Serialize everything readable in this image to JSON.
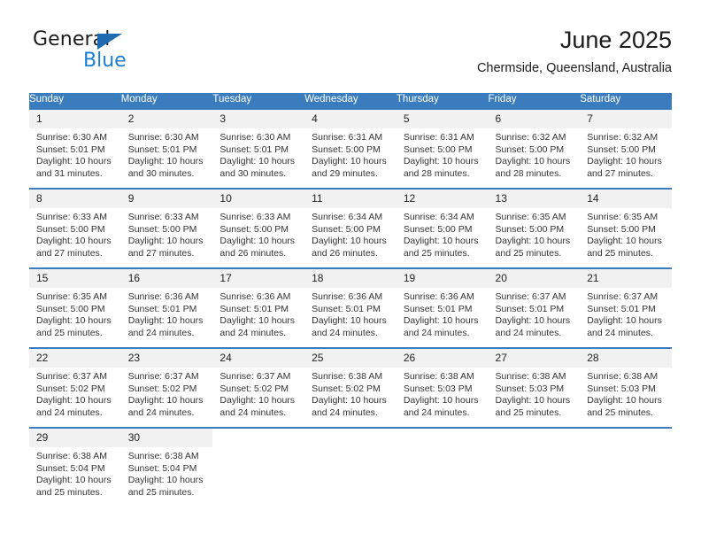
{
  "brand": {
    "word_one": "General",
    "word_two": "Blue",
    "triangle_icon": "triangle-icon",
    "accent_dark": "#1e69b0",
    "accent_light": "#1a7fd4"
  },
  "header": {
    "title": "June 2025",
    "location": "Chermside, Queensland, Australia"
  },
  "theme": {
    "header_blue": "#3a7cbe",
    "daynum_gray": "#f1f1f1",
    "text": "#222222"
  },
  "calendar": {
    "weekday_headers": [
      "Sunday",
      "Monday",
      "Tuesday",
      "Wednesday",
      "Thursday",
      "Friday",
      "Saturday"
    ],
    "weeks": [
      [
        {
          "day": "1",
          "sunrise": "Sunrise: 6:30 AM",
          "sunset": "Sunset: 5:01 PM",
          "daylight_line1": "Daylight: 10 hours",
          "daylight_line2": "and 31 minutes."
        },
        {
          "day": "2",
          "sunrise": "Sunrise: 6:30 AM",
          "sunset": "Sunset: 5:01 PM",
          "daylight_line1": "Daylight: 10 hours",
          "daylight_line2": "and 30 minutes."
        },
        {
          "day": "3",
          "sunrise": "Sunrise: 6:30 AM",
          "sunset": "Sunset: 5:01 PM",
          "daylight_line1": "Daylight: 10 hours",
          "daylight_line2": "and 30 minutes."
        },
        {
          "day": "4",
          "sunrise": "Sunrise: 6:31 AM",
          "sunset": "Sunset: 5:00 PM",
          "daylight_line1": "Daylight: 10 hours",
          "daylight_line2": "and 29 minutes."
        },
        {
          "day": "5",
          "sunrise": "Sunrise: 6:31 AM",
          "sunset": "Sunset: 5:00 PM",
          "daylight_line1": "Daylight: 10 hours",
          "daylight_line2": "and 28 minutes."
        },
        {
          "day": "6",
          "sunrise": "Sunrise: 6:32 AM",
          "sunset": "Sunset: 5:00 PM",
          "daylight_line1": "Daylight: 10 hours",
          "daylight_line2": "and 28 minutes."
        },
        {
          "day": "7",
          "sunrise": "Sunrise: 6:32 AM",
          "sunset": "Sunset: 5:00 PM",
          "daylight_line1": "Daylight: 10 hours",
          "daylight_line2": "and 27 minutes."
        }
      ],
      [
        {
          "day": "8",
          "sunrise": "Sunrise: 6:33 AM",
          "sunset": "Sunset: 5:00 PM",
          "daylight_line1": "Daylight: 10 hours",
          "daylight_line2": "and 27 minutes."
        },
        {
          "day": "9",
          "sunrise": "Sunrise: 6:33 AM",
          "sunset": "Sunset: 5:00 PM",
          "daylight_line1": "Daylight: 10 hours",
          "daylight_line2": "and 27 minutes."
        },
        {
          "day": "10",
          "sunrise": "Sunrise: 6:33 AM",
          "sunset": "Sunset: 5:00 PM",
          "daylight_line1": "Daylight: 10 hours",
          "daylight_line2": "and 26 minutes."
        },
        {
          "day": "11",
          "sunrise": "Sunrise: 6:34 AM",
          "sunset": "Sunset: 5:00 PM",
          "daylight_line1": "Daylight: 10 hours",
          "daylight_line2": "and 26 minutes."
        },
        {
          "day": "12",
          "sunrise": "Sunrise: 6:34 AM",
          "sunset": "Sunset: 5:00 PM",
          "daylight_line1": "Daylight: 10 hours",
          "daylight_line2": "and 25 minutes."
        },
        {
          "day": "13",
          "sunrise": "Sunrise: 6:35 AM",
          "sunset": "Sunset: 5:00 PM",
          "daylight_line1": "Daylight: 10 hours",
          "daylight_line2": "and 25 minutes."
        },
        {
          "day": "14",
          "sunrise": "Sunrise: 6:35 AM",
          "sunset": "Sunset: 5:00 PM",
          "daylight_line1": "Daylight: 10 hours",
          "daylight_line2": "and 25 minutes."
        }
      ],
      [
        {
          "day": "15",
          "sunrise": "Sunrise: 6:35 AM",
          "sunset": "Sunset: 5:00 PM",
          "daylight_line1": "Daylight: 10 hours",
          "daylight_line2": "and 25 minutes."
        },
        {
          "day": "16",
          "sunrise": "Sunrise: 6:36 AM",
          "sunset": "Sunset: 5:01 PM",
          "daylight_line1": "Daylight: 10 hours",
          "daylight_line2": "and 24 minutes."
        },
        {
          "day": "17",
          "sunrise": "Sunrise: 6:36 AM",
          "sunset": "Sunset: 5:01 PM",
          "daylight_line1": "Daylight: 10 hours",
          "daylight_line2": "and 24 minutes."
        },
        {
          "day": "18",
          "sunrise": "Sunrise: 6:36 AM",
          "sunset": "Sunset: 5:01 PM",
          "daylight_line1": "Daylight: 10 hours",
          "daylight_line2": "and 24 minutes."
        },
        {
          "day": "19",
          "sunrise": "Sunrise: 6:36 AM",
          "sunset": "Sunset: 5:01 PM",
          "daylight_line1": "Daylight: 10 hours",
          "daylight_line2": "and 24 minutes."
        },
        {
          "day": "20",
          "sunrise": "Sunrise: 6:37 AM",
          "sunset": "Sunset: 5:01 PM",
          "daylight_line1": "Daylight: 10 hours",
          "daylight_line2": "and 24 minutes."
        },
        {
          "day": "21",
          "sunrise": "Sunrise: 6:37 AM",
          "sunset": "Sunset: 5:01 PM",
          "daylight_line1": "Daylight: 10 hours",
          "daylight_line2": "and 24 minutes."
        }
      ],
      [
        {
          "day": "22",
          "sunrise": "Sunrise: 6:37 AM",
          "sunset": "Sunset: 5:02 PM",
          "daylight_line1": "Daylight: 10 hours",
          "daylight_line2": "and 24 minutes."
        },
        {
          "day": "23",
          "sunrise": "Sunrise: 6:37 AM",
          "sunset": "Sunset: 5:02 PM",
          "daylight_line1": "Daylight: 10 hours",
          "daylight_line2": "and 24 minutes."
        },
        {
          "day": "24",
          "sunrise": "Sunrise: 6:37 AM",
          "sunset": "Sunset: 5:02 PM",
          "daylight_line1": "Daylight: 10 hours",
          "daylight_line2": "and 24 minutes."
        },
        {
          "day": "25",
          "sunrise": "Sunrise: 6:38 AM",
          "sunset": "Sunset: 5:02 PM",
          "daylight_line1": "Daylight: 10 hours",
          "daylight_line2": "and 24 minutes."
        },
        {
          "day": "26",
          "sunrise": "Sunrise: 6:38 AM",
          "sunset": "Sunset: 5:03 PM",
          "daylight_line1": "Daylight: 10 hours",
          "daylight_line2": "and 24 minutes."
        },
        {
          "day": "27",
          "sunrise": "Sunrise: 6:38 AM",
          "sunset": "Sunset: 5:03 PM",
          "daylight_line1": "Daylight: 10 hours",
          "daylight_line2": "and 25 minutes."
        },
        {
          "day": "28",
          "sunrise": "Sunrise: 6:38 AM",
          "sunset": "Sunset: 5:03 PM",
          "daylight_line1": "Daylight: 10 hours",
          "daylight_line2": "and 25 minutes."
        }
      ],
      [
        {
          "day": "29",
          "sunrise": "Sunrise: 6:38 AM",
          "sunset": "Sunset: 5:04 PM",
          "daylight_line1": "Daylight: 10 hours",
          "daylight_line2": "and 25 minutes."
        },
        {
          "day": "30",
          "sunrise": "Sunrise: 6:38 AM",
          "sunset": "Sunset: 5:04 PM",
          "daylight_line1": "Daylight: 10 hours",
          "daylight_line2": "and 25 minutes."
        },
        {
          "day": "",
          "sunrise": "",
          "sunset": "",
          "daylight_line1": "",
          "daylight_line2": ""
        },
        {
          "day": "",
          "sunrise": "",
          "sunset": "",
          "daylight_line1": "",
          "daylight_line2": ""
        },
        {
          "day": "",
          "sunrise": "",
          "sunset": "",
          "daylight_line1": "",
          "daylight_line2": ""
        },
        {
          "day": "",
          "sunrise": "",
          "sunset": "",
          "daylight_line1": "",
          "daylight_line2": ""
        },
        {
          "day": "",
          "sunrise": "",
          "sunset": "",
          "daylight_line1": "",
          "daylight_line2": ""
        }
      ]
    ]
  }
}
